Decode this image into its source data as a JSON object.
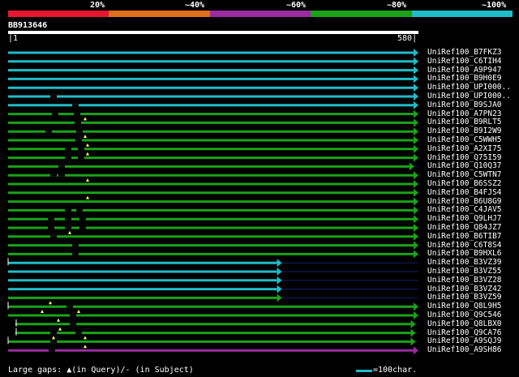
{
  "legend": {
    "labels": [
      "20%",
      "~40%",
      "~60%",
      "~80%",
      "~100%"
    ],
    "colors": [
      "#e8162f",
      "#e0701a",
      "#9a2ca0",
      "#1aa318",
      "#1fbcc8"
    ]
  },
  "query": {
    "id": "BB913646",
    "start": "1",
    "end": "580"
  },
  "hits": [
    {
      "label": "UniRef100_B7FKZ3",
      "color": "#1fbcc8",
      "start": 1,
      "end": 580,
      "tick": null,
      "gaps": [],
      "marks": []
    },
    {
      "label": "UniRef100_C6TIH4",
      "color": "#1fbcc8",
      "start": 1,
      "end": 580,
      "tick": null,
      "gaps": [],
      "marks": []
    },
    {
      "label": "UniRef100_A9P947",
      "color": "#1fbcc8",
      "start": 1,
      "end": 580,
      "tick": null,
      "gaps": [],
      "marks": []
    },
    {
      "label": "UniRef100_B9H0E9",
      "color": "#1fbcc8",
      "start": 1,
      "end": 580,
      "tick": null,
      "gaps": [],
      "marks": []
    },
    {
      "label": "UniRef100_UPI000..",
      "color": "#1fbcc8",
      "start": 1,
      "end": 580,
      "tick": null,
      "gaps": [],
      "marks": []
    },
    {
      "label": "UniRef100_UPI000..",
      "color": "#1fbcc8",
      "start": 1,
      "end": 580,
      "tick": null,
      "gaps": [
        66
      ],
      "marks": []
    },
    {
      "label": "UniRef100_B9SJA0",
      "color": "#1fbcc8",
      "start": 1,
      "end": 580,
      "tick": null,
      "gaps": [
        93
      ],
      "marks": []
    },
    {
      "label": "UniRef100_A7PN23",
      "color": "#1aa318",
      "start": 1,
      "end": 580,
      "tick": null,
      "gaps": [
        68,
        95
      ],
      "marks": []
    },
    {
      "label": "UniRef100_B9RLT5",
      "color": "#1aa318",
      "start": 1,
      "end": 580,
      "tick": null,
      "gaps": [
        96
      ],
      "marks": [
        105
      ]
    },
    {
      "label": "UniRef100_B9I2W9",
      "color": "#1aa318",
      "start": 1,
      "end": 580,
      "tick": null,
      "gaps": [
        60,
        98
      ],
      "marks": []
    },
    {
      "label": "UniRef100_C5WWH5",
      "color": "#1aa318",
      "start": 1,
      "end": 580,
      "tick": null,
      "gaps": [
        97
      ],
      "marks": [
        105
      ]
    },
    {
      "label": "UniRef100_A2XI75",
      "color": "#1aa318",
      "start": 1,
      "end": 580,
      "tick": null,
      "gaps": [
        84,
        100
      ],
      "marks": [
        108
      ]
    },
    {
      "label": "UniRef100_Q75I59",
      "color": "#1aa318",
      "start": 1,
      "end": 580,
      "tick": null,
      "gaps": [
        84,
        100
      ],
      "marks": [
        108
      ]
    },
    {
      "label": "UniRef100_Q10Q37",
      "color": "#1aa318",
      "start": 1,
      "end": 574,
      "tick": null,
      "gaps": [
        76
      ],
      "marks": []
    },
    {
      "label": "UniRef100_C5WTN7",
      "color": "#1aa318",
      "start": 1,
      "end": 580,
      "tick": null,
      "gaps": [
        66,
        76
      ],
      "marks": []
    },
    {
      "label": "UniRef100_B6SSZ2",
      "color": "#1aa318",
      "start": 1,
      "end": 580,
      "tick": null,
      "gaps": [],
      "marks": [
        108
      ]
    },
    {
      "label": "UniRef100_B4FJS4",
      "color": "#1aa318",
      "start": 1,
      "end": 580,
      "tick": null,
      "gaps": [],
      "marks": []
    },
    {
      "label": "UniRef100_B6U8G9",
      "color": "#1aa318",
      "start": 1,
      "end": 580,
      "tick": null,
      "gaps": [],
      "marks": [
        108
      ]
    },
    {
      "label": "UniRef100_C4JAV5",
      "color": "#1aa318",
      "start": 1,
      "end": 580,
      "tick": null,
      "gaps": [
        84,
        98
      ],
      "marks": []
    },
    {
      "label": "UniRef100_Q9LHJ7",
      "color": "#1aa318",
      "start": 1,
      "end": 580,
      "tick": null,
      "gaps": [
        63,
        84,
        102
      ],
      "marks": []
    },
    {
      "label": "UniRef100_Q84JZ7",
      "color": "#1aa318",
      "start": 1,
      "end": 580,
      "tick": null,
      "gaps": [
        63,
        84,
        102
      ],
      "marks": []
    },
    {
      "label": "UniRef100_B6TIB7",
      "color": "#1aa318",
      "start": 1,
      "end": 580,
      "tick": null,
      "gaps": [
        66
      ],
      "marks": [
        86
      ]
    },
    {
      "label": "UniRef100_C6T8S4",
      "color": "#1aa318",
      "start": 1,
      "end": 580,
      "tick": null,
      "gaps": [
        93
      ],
      "marks": []
    },
    {
      "label": "UniRef100_B9HXL6",
      "color": "#1aa318",
      "start": 1,
      "end": 580,
      "tick": null,
      "gaps": [
        93
      ],
      "marks": []
    },
    {
      "label": "UniRef100_B3VZ39",
      "color": "#1fbcc8",
      "start": 1,
      "end": 385,
      "tick": 10,
      "gaps": [],
      "marks": []
    },
    {
      "label": "UniRef100_B3VZ55",
      "color": "#1fbcc8",
      "start": 1,
      "end": 385,
      "tick": null,
      "gaps": [],
      "marks": []
    },
    {
      "label": "UniRef100_B3VZ28",
      "color": "#1fbcc8",
      "start": 1,
      "end": 385,
      "tick": null,
      "gaps": [],
      "marks": []
    },
    {
      "label": "UniRef100_B3VZ42",
      "color": "#1fbcc8",
      "start": 1,
      "end": 385,
      "tick": null,
      "gaps": [],
      "marks": []
    },
    {
      "label": "UniRef100_B3VZ59",
      "color": "#1aa318",
      "start": 1,
      "end": 385,
      "tick": null,
      "gaps": [],
      "marks": []
    },
    {
      "label": "UniRef100_Q8L9H5",
      "color": "#1aa318",
      "start": 1,
      "end": 580,
      "tick": 10,
      "gaps": [
        86
      ],
      "marks": [
        62
      ]
    },
    {
      "label": "UniRef100_Q9C546",
      "color": "#1aa318",
      "start": 1,
      "end": 580,
      "tick": null,
      "gaps": [
        90
      ],
      "marks": [
        52,
        97
      ]
    },
    {
      "label": "UniRef100_Q8LBX0",
      "color": "#1aa318",
      "start": 11,
      "end": 576,
      "tick": 20,
      "gaps": [
        90
      ],
      "marks": [
        72
      ]
    },
    {
      "label": "UniRef100_Q9CA76",
      "color": "#1aa318",
      "start": 11,
      "end": 576,
      "tick": 20,
      "gaps": [
        66,
        97
      ],
      "marks": [
        74
      ]
    },
    {
      "label": "UniRef100_A9SQJ9",
      "color": "#1aa318",
      "start": 1,
      "end": 576,
      "tick": 10,
      "gaps": [
        66
      ],
      "marks": [
        66,
        105
      ]
    },
    {
      "label": "UniRef100_A9SH86",
      "color": "#9a2ca0",
      "start": 1,
      "end": 580,
      "tick": null,
      "gaps": [
        64
      ],
      "marks": [
        105
      ]
    }
  ],
  "footer": {
    "note": "Large gaps: ▲(in Query)/- (in Subject)",
    "scale_label": "=100char.",
    "scale_color": "#1fbcc8"
  }
}
